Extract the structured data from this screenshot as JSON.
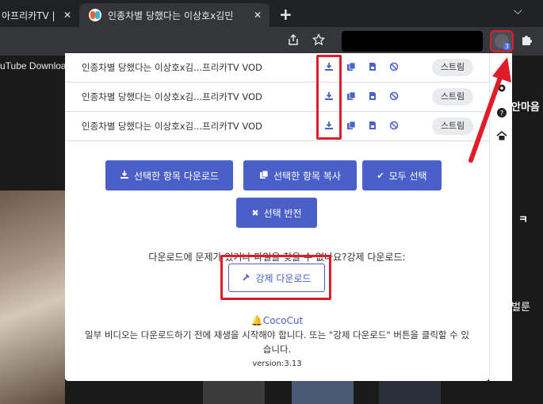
{
  "browser": {
    "tabs": [
      {
        "title": "아프리카TV |"
      },
      {
        "title": "인종차별 당했다는 이상호x김민"
      }
    ],
    "new_tab": "+",
    "tab_menu": "⌵",
    "extension_badge": "3"
  },
  "page": {
    "bookmark_text": "uTube Downloa",
    "right_texts": [
      "안마음",
      "ㅋ",
      "벌룬"
    ]
  },
  "popup": {
    "rows": [
      {
        "name": "인종차별 당했다는 이상호x김...프리카TV VOD",
        "stream_label": "스트림"
      },
      {
        "name": "인종차별 당했다는 이상호x김...프리카TV VOD",
        "stream_label": "스트림"
      },
      {
        "name": "인종차별 당했다는 이상호x김...프리카TV VOD",
        "stream_label": "스트림"
      }
    ],
    "buttons": {
      "download_selected": "선택한 항목 다운로드",
      "copy_selected": "선택한 항목 복사",
      "select_all": "모두 선택",
      "invert_selection": "선택 반전"
    },
    "help_text": "다운로드에 문제가 있거나 파일을 찾을 수 없나요?강제 다운로드:",
    "force_download": "강제 다운로드",
    "brand": "CocoCut",
    "note": "일부 비디오는 다운로드하기 전에 재생을 시작해야 합니다. 또는 \"강제 다운로드\" 버튼을 클릭할 수 있습니다.",
    "version": "version:3.13"
  },
  "colors": {
    "accent": "#4a60c8",
    "highlight": "#e01c2b",
    "chrome_dark": "#202124",
    "chrome_toolbar": "#35363a"
  }
}
